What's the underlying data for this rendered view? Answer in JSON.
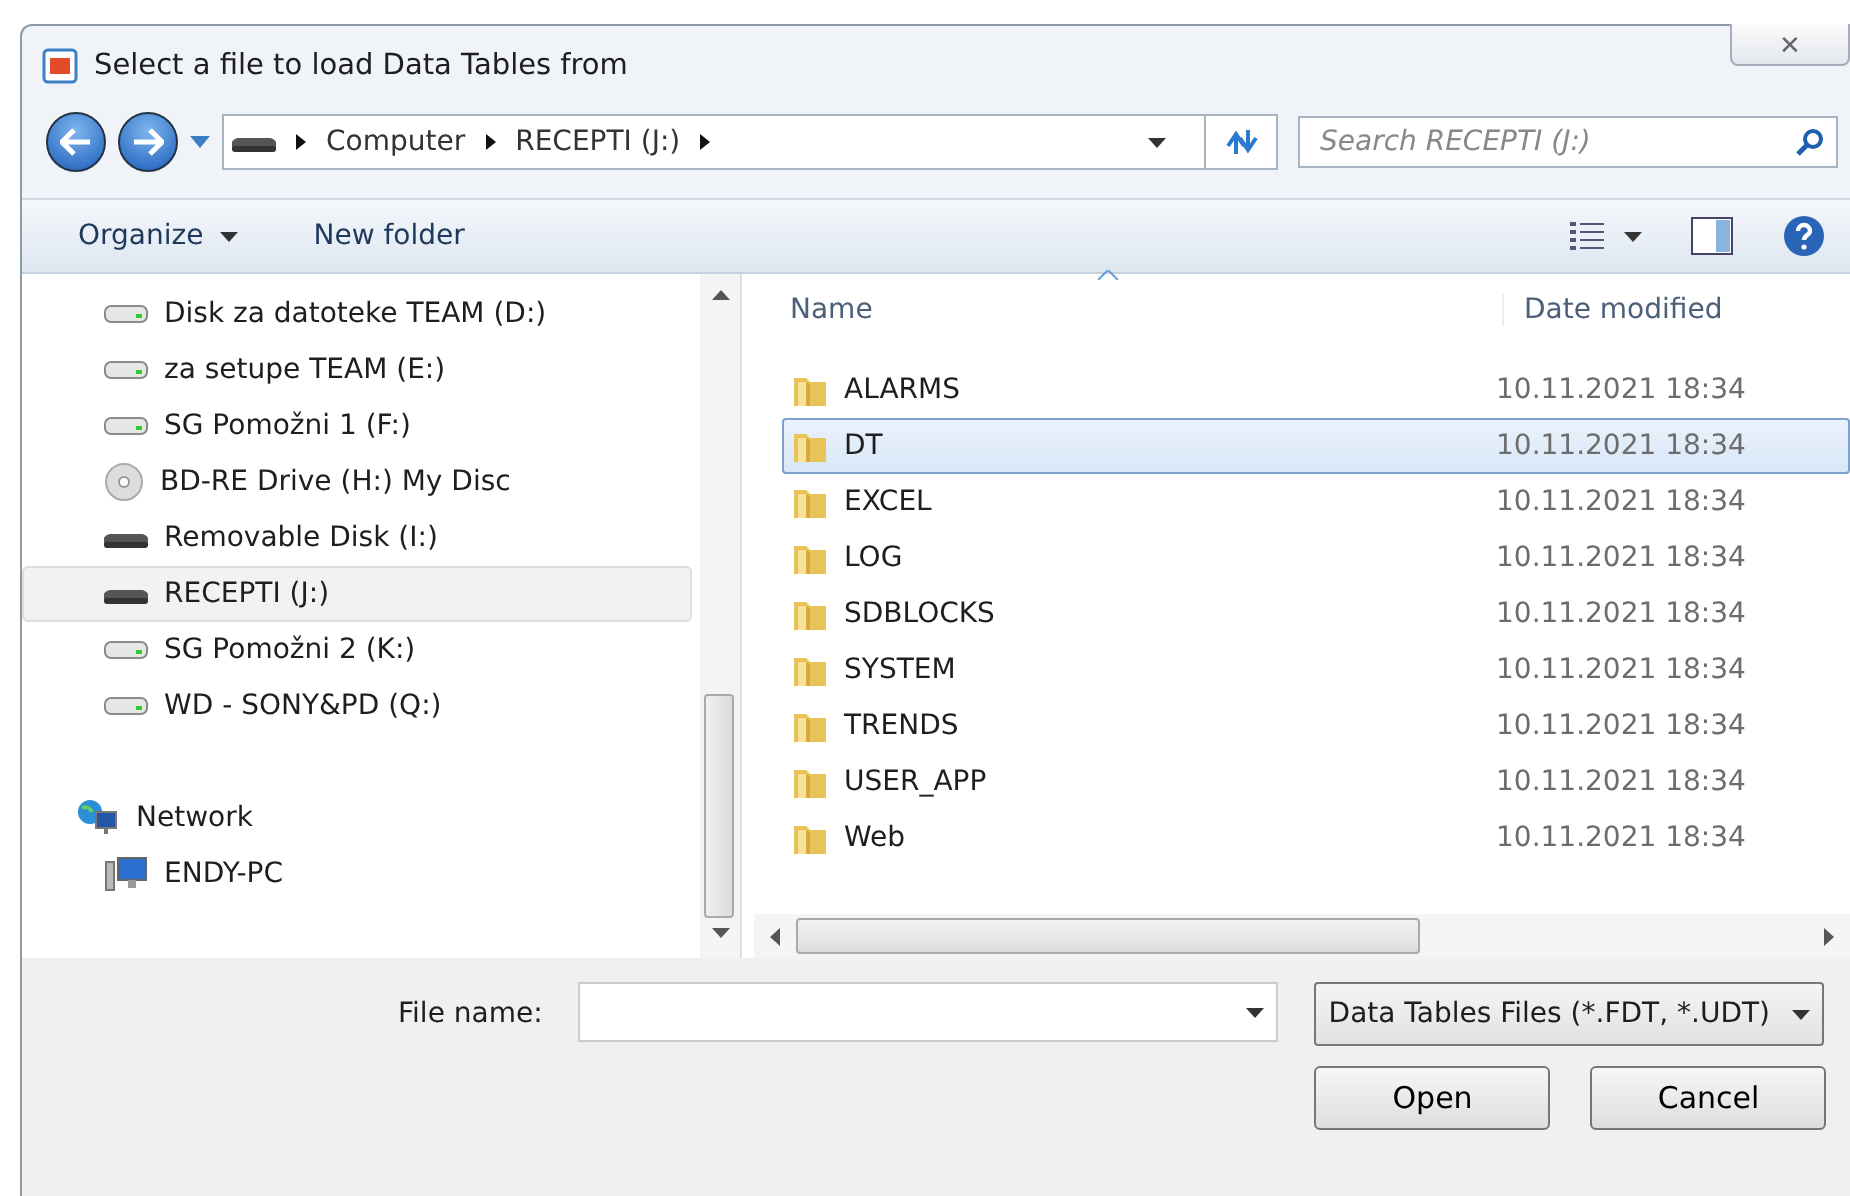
{
  "window": {
    "title": "Select a file to load Data Tables from",
    "close": "✕"
  },
  "address": {
    "crumbs": [
      "Computer",
      "RECEPTI (J:)"
    ]
  },
  "search": {
    "placeholder": "Search RECEPTI (J:)"
  },
  "toolbar": {
    "organize": "Organize",
    "new_folder": "New folder"
  },
  "sidebar": {
    "items": [
      {
        "label": "Disk za datoteke TEAM (D:)",
        "kind": "drive",
        "selected": false
      },
      {
        "label": "za setupe TEAM (E:)",
        "kind": "drive",
        "selected": false
      },
      {
        "label": "SG Pomožni 1 (F:)",
        "kind": "drive",
        "selected": false
      },
      {
        "label": "BD-RE Drive (H:) My Disc",
        "kind": "disc",
        "selected": false
      },
      {
        "label": "Removable Disk (I:)",
        "kind": "removable",
        "selected": false
      },
      {
        "label": "RECEPTI (J:)",
        "kind": "removable",
        "selected": true
      },
      {
        "label": "SG Pomožni 2 (K:)",
        "kind": "drive",
        "selected": false
      },
      {
        "label": "WD - SONY&PD (Q:)",
        "kind": "drive",
        "selected": false
      },
      {
        "label": "Network",
        "kind": "network",
        "selected": false
      },
      {
        "label": "ENDY-PC",
        "kind": "computer",
        "selected": false
      }
    ]
  },
  "table": {
    "columns": [
      "Name",
      "Date modified"
    ],
    "rows": [
      {
        "name": "ALARMS",
        "date": "10.11.2021 18:34",
        "selected": false
      },
      {
        "name": "DT",
        "date": "10.11.2021 18:34",
        "selected": true
      },
      {
        "name": "EXCEL",
        "date": "10.11.2021 18:34",
        "selected": false
      },
      {
        "name": "LOG",
        "date": "10.11.2021 18:34",
        "selected": false
      },
      {
        "name": "SDBLOCKS",
        "date": "10.11.2021 18:34",
        "selected": false
      },
      {
        "name": "SYSTEM",
        "date": "10.11.2021 18:34",
        "selected": false
      },
      {
        "name": "TRENDS",
        "date": "10.11.2021 18:34",
        "selected": false
      },
      {
        "name": "USER_APP",
        "date": "10.11.2021 18:34",
        "selected": false
      },
      {
        "name": "Web",
        "date": "10.11.2021 18:34",
        "selected": false
      }
    ]
  },
  "footer": {
    "file_name_label": "File name:",
    "file_type": "Data Tables Files (*.FDT, *.UDT)",
    "buttons": [
      "Open",
      "Cancel"
    ]
  }
}
